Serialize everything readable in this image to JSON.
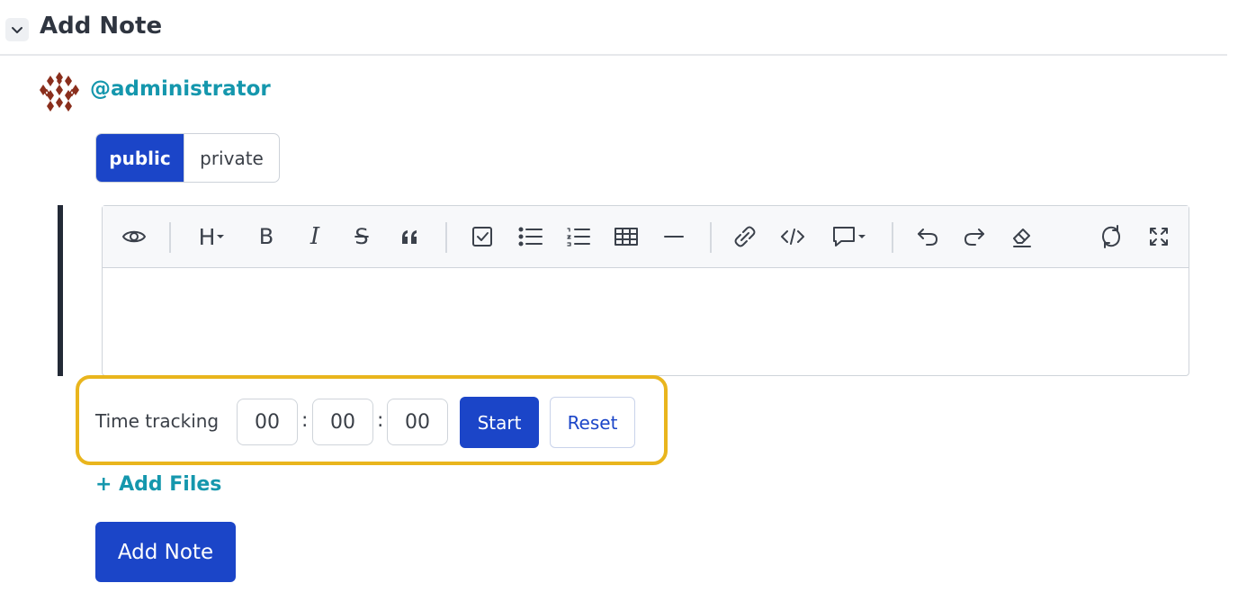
{
  "section": {
    "title": "Add Note",
    "collapse_icon": "chevron-down-icon"
  },
  "author": {
    "handle": "@administrator",
    "avatar": "identicon-avatar"
  },
  "visibility": {
    "options": [
      "public",
      "private"
    ],
    "selected": "public"
  },
  "editor": {
    "toolbar": {
      "preview": "eye-icon",
      "heading": "H",
      "bold": "B",
      "italic": "I",
      "strike": "S",
      "quote": "quote-icon",
      "task_list": "checkbox-icon",
      "bullet_list": "bullet-list-icon",
      "ordered_list": "ordered-list-icon",
      "table": "table-icon",
      "horizontal_rule": "horizontal-rule-icon",
      "link": "link-icon",
      "code": "code-icon",
      "comment": "comment-icon",
      "undo": "undo-icon",
      "redo": "redo-icon",
      "clear_format": "eraser-icon",
      "sync": "sync-icon",
      "fullscreen": "fullscreen-icon"
    },
    "content": ""
  },
  "time_tracking": {
    "label": "Time tracking",
    "hours": "00",
    "minutes": "00",
    "seconds": "00",
    "separator": ":",
    "start_label": "Start",
    "reset_label": "Reset",
    "highlight_color": "#e9b51d"
  },
  "add_files_label": "+ Add Files",
  "submit_label": "Add Note",
  "colors": {
    "primary": "#1b45c8",
    "link": "#1597ad"
  }
}
